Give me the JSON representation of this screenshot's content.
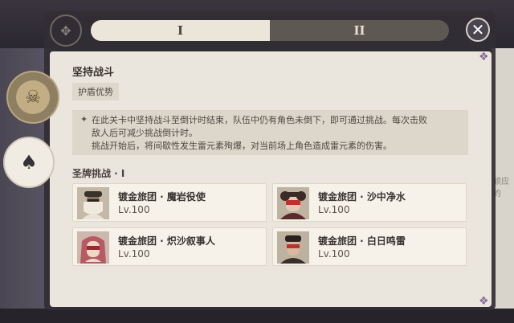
{
  "header": {
    "tabs": [
      {
        "label": "I",
        "active": true
      },
      {
        "label": "II",
        "active": false
      }
    ],
    "close_icon": "close-x-icon"
  },
  "background": {
    "partial_text": "顽应的"
  },
  "side_tabs": [
    {
      "icon": "horned-mask-icon",
      "active": false
    },
    {
      "icon": "theater-masks-icon",
      "active": true
    }
  ],
  "challenge": {
    "title": "坚持战斗",
    "tag": "护盾优势",
    "description": [
      "在此关卡中坚持战斗至倒计时结束，队伍中仍有角色未倒下，即可通过挑战。每次击败",
      "敌人后可减少挑战倒计时。",
      "挑战开始后，将间歇性发生雷元素殉爆，对当前场上角色造成雷元素的伤害。"
    ]
  },
  "enemies": {
    "section_title": "圣牌挑战 · I",
    "list": [
      {
        "name": "镀金旅团 · 魔岩役使",
        "level": "Lv.100"
      },
      {
        "name": "镀金旅团 · 沙中净水",
        "level": "Lv.100"
      },
      {
        "name": "镀金旅团 · 炽沙叙事人",
        "level": "Lv.100"
      },
      {
        "name": "镀金旅团 · 白日鸣雷",
        "level": "Lv.100"
      }
    ]
  },
  "colors": {
    "panel": "#ebe6dd",
    "card": "#f6f2ea",
    "accent_purple": "#8a6a9a"
  }
}
